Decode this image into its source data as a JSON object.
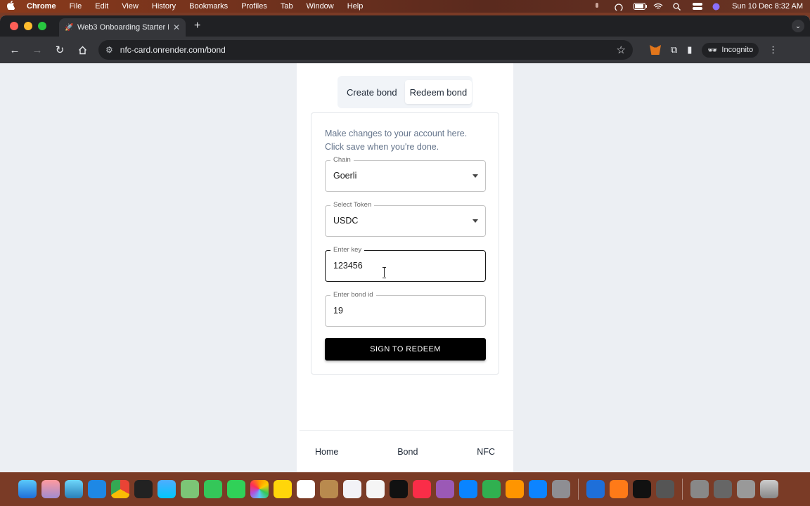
{
  "menubar": {
    "app_name": "Chrome",
    "items": [
      "File",
      "Edit",
      "View",
      "History",
      "Bookmarks",
      "Profiles",
      "Tab",
      "Window",
      "Help"
    ],
    "clock": "Sun 10 Dec  8:32 AM"
  },
  "browser": {
    "tab_title": "Web3 Onboarding Starter Kit",
    "url": "nfc-card.onrender.com/bond",
    "incognito_label": "Incognito"
  },
  "page": {
    "tabs": [
      "Create bond",
      "Redeem bond"
    ],
    "active_tab": "Redeem bond",
    "description": "Make changes to your account here. Click save when you're done.",
    "fields": {
      "chain": {
        "label": "Chain",
        "value": "Goerli"
      },
      "token": {
        "label": "Select Token",
        "value": "USDC"
      },
      "key": {
        "label": "Enter key",
        "value": "123456"
      },
      "bond_id": {
        "label": "Enter bond id",
        "value": "19"
      }
    },
    "submit_label": "SIGN TO REDEEM",
    "nav": [
      "Home",
      "Bond",
      "NFC"
    ]
  },
  "colors": {
    "button_bg": "#000000",
    "page_bg": "#eceff3",
    "description_text": "#64748b"
  }
}
